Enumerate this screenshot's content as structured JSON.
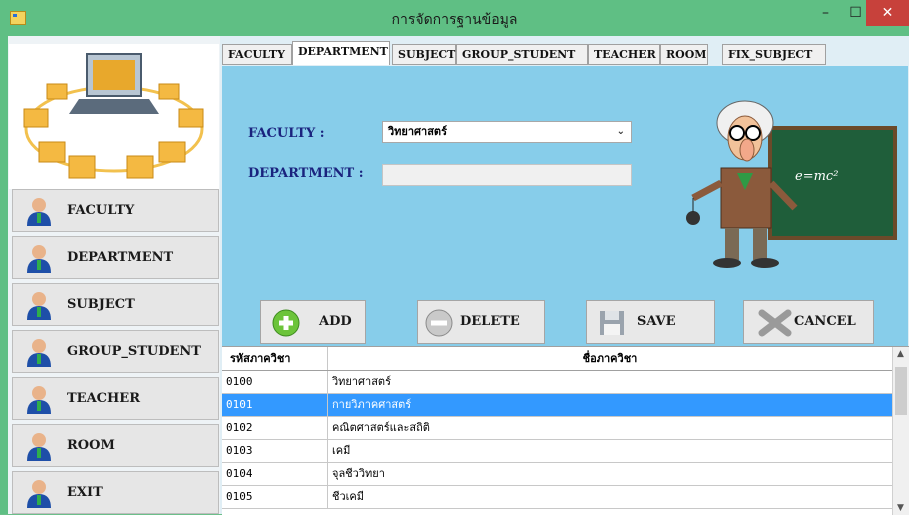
{
  "window": {
    "title": "การจัดการฐานข้อมูล",
    "minimize": "–",
    "maximize": "☐",
    "close": "✕"
  },
  "sidebar": {
    "items": [
      {
        "label": "FACULTY"
      },
      {
        "label": "DEPARTMENT"
      },
      {
        "label": "SUBJECT"
      },
      {
        "label": "GROUP_STUDENT"
      },
      {
        "label": "TEACHER"
      },
      {
        "label": "ROOM"
      },
      {
        "label": "EXIT"
      }
    ]
  },
  "tabs": [
    {
      "label": "FACULTY"
    },
    {
      "label": "DEPARTMENT"
    },
    {
      "label": "SUBJECT"
    },
    {
      "label": "GROUP_STUDENT"
    },
    {
      "label": "TEACHER"
    },
    {
      "label": "ROOM"
    },
    {
      "label": "FIX_SUBJECT"
    }
  ],
  "active_tab": "DEPARTMENT",
  "form": {
    "faculty_label": "FACULTY :",
    "faculty_value": "วิทยาศาสตร์",
    "department_label": "DEPARTMENT :",
    "department_value": ""
  },
  "actions": {
    "add": "ADD",
    "delete": "DELETE",
    "save": "SAVE",
    "cancel": "CANCEL"
  },
  "grid": {
    "columns": [
      "รหัสภาควิชา",
      "ชื่อภาควิชา"
    ],
    "rows": [
      {
        "code": "0100",
        "name": "วิทยาศาสตร์"
      },
      {
        "code": "0101",
        "name": "กายวิภาคศาสตร์",
        "selected": true
      },
      {
        "code": "0102",
        "name": "คณิตศาสตร์และสถิติ"
      },
      {
        "code": "0103",
        "name": "เคมี"
      },
      {
        "code": "0104",
        "name": "จุลชีววิทยา"
      },
      {
        "code": "0105",
        "name": "ชีวเคมี"
      }
    ]
  },
  "colors": {
    "titlebar": "#5fbf84",
    "main_bg": "#87cdea",
    "selection": "#3399ff",
    "label_text": "#1a237e"
  }
}
